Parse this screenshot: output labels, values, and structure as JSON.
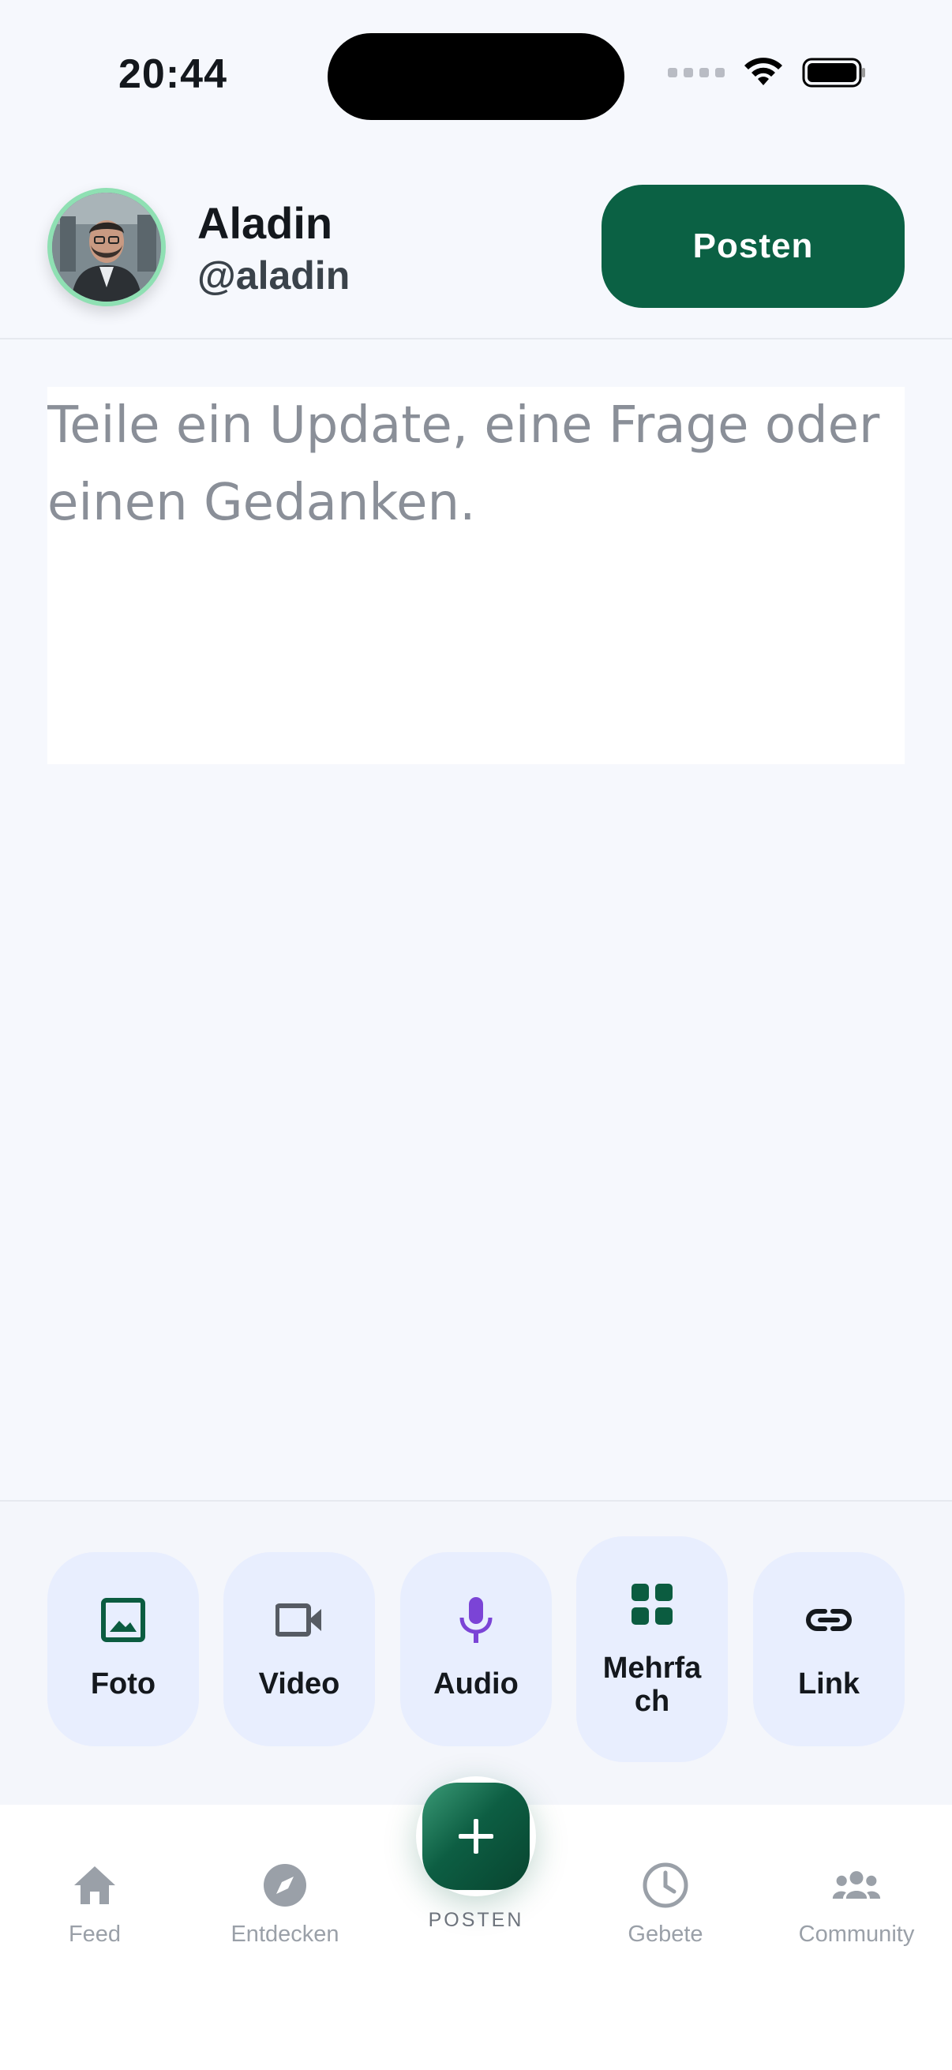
{
  "status_bar": {
    "time": "20:44"
  },
  "user": {
    "name": "Aladin",
    "handle": "@aladin"
  },
  "header": {
    "post_button": "Posten"
  },
  "composer": {
    "placeholder": "Teile ein Update, eine Frage oder einen Gedanken.",
    "value": ""
  },
  "attachments": [
    {
      "label": "Foto",
      "icon": "image-icon",
      "color": "#0b5c40"
    },
    {
      "label": "Video",
      "icon": "video-camera-icon",
      "color": "#565b63"
    },
    {
      "label": "Audio",
      "icon": "microphone-icon",
      "color": "#7b44d6"
    },
    {
      "label": "Mehrfach",
      "icon": "grid-icon",
      "color": "#0b5c40"
    },
    {
      "label": "Link",
      "icon": "link-icon",
      "color": "#14181d"
    }
  ],
  "nav": {
    "items": [
      {
        "label": "Feed",
        "icon": "home-icon"
      },
      {
        "label": "Entdecken",
        "icon": "compass-icon"
      },
      {
        "label": "POSTEN",
        "icon": "plus-icon"
      },
      {
        "label": "Gebete",
        "icon": "clock-icon"
      },
      {
        "label": "Community",
        "icon": "people-icon"
      }
    ]
  },
  "colors": {
    "accent": "#0b6144",
    "avatar_ring": "#8fe0b3",
    "tile_bg": "#e8eefe",
    "nav_inactive": "#9aa0a8"
  }
}
